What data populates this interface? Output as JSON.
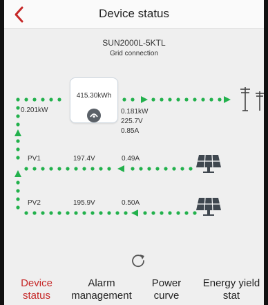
{
  "header": {
    "title": "Device status"
  },
  "device": {
    "name": "SUN2000L-5KTL",
    "status": "Grid connection"
  },
  "inverter": {
    "energy": "415.30kWh"
  },
  "grid": {
    "power": "0.181kW",
    "voltage": "225.7V",
    "current": "0.85A"
  },
  "input": {
    "power": "0.201kW"
  },
  "pv": [
    {
      "name": "PV1",
      "voltage": "197.4V",
      "current": "0.49A"
    },
    {
      "name": "PV2",
      "voltage": "195.9V",
      "current": "0.50A"
    }
  ],
  "tabs": [
    {
      "line1": "Device",
      "line2": "status"
    },
    {
      "line1": "Alarm",
      "line2": "management"
    },
    {
      "line1": "Power",
      "line2": "curve"
    },
    {
      "line1": "Energy yield",
      "line2": "stat"
    }
  ],
  "colors": {
    "accent": "#c62828",
    "flow": "#22b14c",
    "background": "#efefef"
  },
  "icons": [
    "back-arrow-icon",
    "inverter-logo-icon",
    "power-tower-icon",
    "solar-panel-icon",
    "refresh-icon"
  ]
}
